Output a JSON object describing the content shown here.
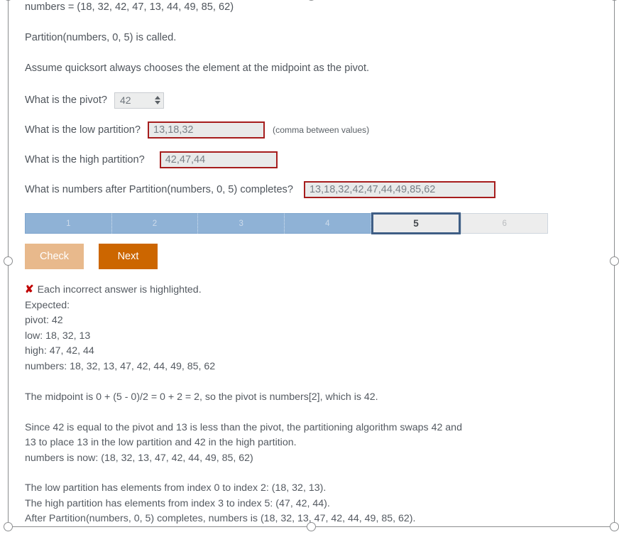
{
  "prompt": {
    "numbers_line": "numbers = (18, 32, 42, 47, 13, 44, 49, 85, 62)",
    "call_line": "Partition(numbers, 0, 5) is called.",
    "assume_line": "Assume quicksort always chooses the element at the midpoint as the pivot."
  },
  "questions": {
    "pivot": {
      "label": "What is the pivot?",
      "value": "42"
    },
    "low": {
      "label": "What is the low partition?",
      "value": "13,18,32",
      "hint": "(comma between values)"
    },
    "high": {
      "label": "What is the high partition?",
      "value": "42,47,44"
    },
    "after": {
      "label": "What is numbers after Partition(numbers, 0, 5) completes?",
      "value": "13,18,32,42,47,44,49,85,62"
    }
  },
  "steps": [
    {
      "label": "1",
      "state": "done"
    },
    {
      "label": "2",
      "state": "done"
    },
    {
      "label": "3",
      "state": "done"
    },
    {
      "label": "4",
      "state": "done"
    },
    {
      "label": "5",
      "state": "current"
    },
    {
      "label": "6",
      "state": "todo"
    }
  ],
  "buttons": {
    "check": "Check",
    "next": "Next"
  },
  "feedback": {
    "icon": "x-mark-icon",
    "headline": "Each incorrect answer is highlighted.",
    "expected_label": "Expected:",
    "expected": [
      "pivot: 42",
      "low: 18, 32, 13",
      "high: 47, 42, 44",
      "numbers: 18, 32, 13, 47, 42, 44, 49, 85, 62"
    ]
  },
  "explanation": {
    "p1": "The midpoint is 0 + (5 - 0)/2 = 0 + 2 = 2, so the pivot is numbers[2], which is 42.",
    "p2_l1": "Since 42 is equal to the pivot and 13 is less than the pivot, the partitioning algorithm swaps 42 and",
    "p2_l2": "13 to place 13 in the low partition and 42 in the high partition.",
    "p2_l3": "numbers is now: (18, 32, 13, 47, 42, 44, 49, 85, 62)",
    "p3_l1": "The low partition has elements from index 0 to index 2: (18, 32, 13).",
    "p3_l2": "The high partition has elements from index 3 to index 5: (47, 42, 44).",
    "p3_l3": "After Partition(numbers, 0, 5) completes, numbers is (18, 32, 13, 47, 42, 44, 49, 85, 62)."
  },
  "colors": {
    "error_border": "#a61d1d",
    "error_mark": "#c00000",
    "step_done": "#8fb2d6",
    "step_current_border": "#3f5e85",
    "check_button": "#e8b98c",
    "next_button": "#cc6600"
  }
}
